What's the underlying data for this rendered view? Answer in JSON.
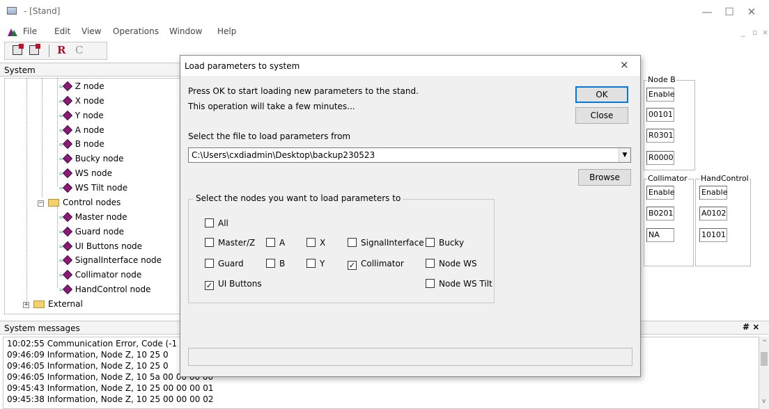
{
  "window": {
    "title": "- [Stand]"
  },
  "menu": {
    "items": [
      "File",
      "Edit",
      "View",
      "Operations",
      "Window",
      "Help"
    ]
  },
  "toolbar": {
    "letters": [
      "R",
      "C"
    ]
  },
  "system_panel": {
    "title": "System",
    "tree": [
      {
        "label": "Z node",
        "type": "node"
      },
      {
        "label": "X node",
        "type": "node"
      },
      {
        "label": "Y node",
        "type": "node"
      },
      {
        "label": "A node",
        "type": "node"
      },
      {
        "label": "B node",
        "type": "node"
      },
      {
        "label": "Bucky node",
        "type": "node"
      },
      {
        "label": "WS node",
        "type": "node"
      },
      {
        "label": "WS Tilt node",
        "type": "node"
      },
      {
        "label": "Control nodes",
        "type": "folder",
        "expander": "−"
      },
      {
        "label": "Master node",
        "type": "node"
      },
      {
        "label": "Guard node",
        "type": "node"
      },
      {
        "label": "UI Buttons node",
        "type": "node"
      },
      {
        "label": "SignalInterface node",
        "type": "node"
      },
      {
        "label": "Collimator node",
        "type": "node"
      },
      {
        "label": "HandControl node",
        "type": "node"
      },
      {
        "label": "External",
        "type": "folder",
        "expander": "+"
      }
    ]
  },
  "right_panel": {
    "node_b": {
      "title": "Node B",
      "fields": [
        "Enable",
        "00101",
        "R0301",
        "R0000"
      ]
    },
    "collimator": {
      "title": "Collimator",
      "fields": [
        "Enable",
        "B0201",
        "NA"
      ]
    },
    "handcontrol": {
      "title": "HandControl",
      "fields": [
        "Enable",
        "A0102",
        "10101"
      ]
    }
  },
  "messages": {
    "title": "System messages",
    "pin": "# ×",
    "lines": [
      "10:02:55 Communication Error, Code (-1",
      "09:46:09 Information, Node Z, 10 25 0",
      "09:46:05 Information, Node Z, 10 25 0",
      "09:46:05 Information, Node Z, 10 5a 00 00 00 00",
      "09:45:43 Information, Node Z, 10 25 00 00 00 01",
      "09:45:38 Information, Node Z, 10 25 00 00 00 02"
    ]
  },
  "dialog": {
    "title": "Load parameters to system",
    "close": "×",
    "intro_line1": "Press OK to start loading new parameters to the stand.",
    "intro_line2": "This operation will take a few minutes...",
    "ok_label": "OK",
    "close_label": "Close",
    "file_label": "Select the file to load parameters from",
    "file_value": "C:\\Users\\cxdiadmin\\Desktop\\backup230523",
    "browse_label": "Browse",
    "nodes_group_label": "Select the nodes you want to load parameters to",
    "checkboxes": {
      "all": {
        "label": "All",
        "checked": false
      },
      "master_z": {
        "label": "Master/Z",
        "checked": false
      },
      "a": {
        "label": "A",
        "checked": false
      },
      "x": {
        "label": "X",
        "checked": false
      },
      "signal_interface": {
        "label": "SignalInterface",
        "checked": false
      },
      "bucky": {
        "label": "Bucky",
        "checked": false
      },
      "guard": {
        "label": "Guard",
        "checked": false
      },
      "b": {
        "label": "B",
        "checked": false
      },
      "y": {
        "label": "Y",
        "checked": false
      },
      "collimator": {
        "label": "Collimator",
        "checked": true
      },
      "node_ws": {
        "label": "Node WS",
        "checked": false
      },
      "ui_buttons": {
        "label": "UI Buttons",
        "checked": true
      },
      "node_ws_tilt": {
        "label": "Node WS Tilt",
        "checked": false
      }
    },
    "progress": 0
  }
}
